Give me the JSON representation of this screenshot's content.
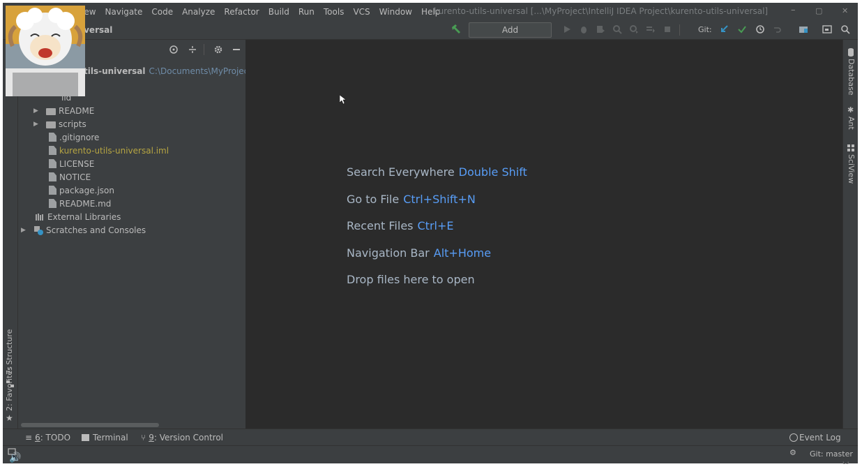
{
  "menu": {
    "items": [
      "iew",
      "Navigate",
      "Code",
      "Analyze",
      "Refactor",
      "Build",
      "Run",
      "Tools",
      "VCS",
      "Window",
      "Help"
    ]
  },
  "window": {
    "title": "kurento-utils-universal [...\\MyProject\\IntelliJ IDEA Project\\kurento-utils-universal]",
    "minimize": "–",
    "restore": "▢",
    "close": "✕"
  },
  "toolbar": {
    "project_crumb": "iversal",
    "add_config_label": "Add Configuration...",
    "git_label": "Git:"
  },
  "project_tree": {
    "root_label": "tils-universal",
    "root_path": "C:\\Documents\\MyProject\\Intel",
    "partial_row": "ild",
    "items": [
      {
        "label": "README",
        "type": "folder"
      },
      {
        "label": "scripts",
        "type": "folder"
      },
      {
        "label": ".gitignore",
        "type": "file"
      },
      {
        "label": "kurento-utils-universal.iml",
        "type": "file"
      },
      {
        "label": "LICENSE",
        "type": "file"
      },
      {
        "label": "NOTICE",
        "type": "file"
      },
      {
        "label": "package.json",
        "type": "file"
      },
      {
        "label": "README.md",
        "type": "file"
      }
    ],
    "external_libraries": "External Libraries",
    "scratches": "Scratches and Consoles"
  },
  "left_tabs": {
    "structure": "7: Structure",
    "favorites": "2: Favorites"
  },
  "right_tabs": {
    "database": "Database",
    "ant": "Ant",
    "sciview": "SciView"
  },
  "editor_hints": [
    {
      "action": "Search Everywhere",
      "shortcut": "Double Shift"
    },
    {
      "action": "Go to File",
      "shortcut": "Ctrl+Shift+N"
    },
    {
      "action": "Recent Files",
      "shortcut": "Ctrl+E"
    },
    {
      "action": "Navigation Bar",
      "shortcut": "Alt+Home"
    },
    {
      "action": "Drop files here to open",
      "shortcut": ""
    }
  ],
  "bottom_tabs": {
    "todo_num": "6",
    "todo_label": ": TODO",
    "terminal": "Terminal",
    "vcs_num": "9",
    "vcs_label": ": Version Control",
    "event_log": "Event Log"
  },
  "status": {
    "git_branch": "Git: master"
  },
  "colors": {
    "accent_blue": "#589df6",
    "build_green": "#499c54",
    "vcs_blue": "#3592c4",
    "frame_bg": "#3c3f41",
    "editor_bg": "#2b2b2b"
  }
}
